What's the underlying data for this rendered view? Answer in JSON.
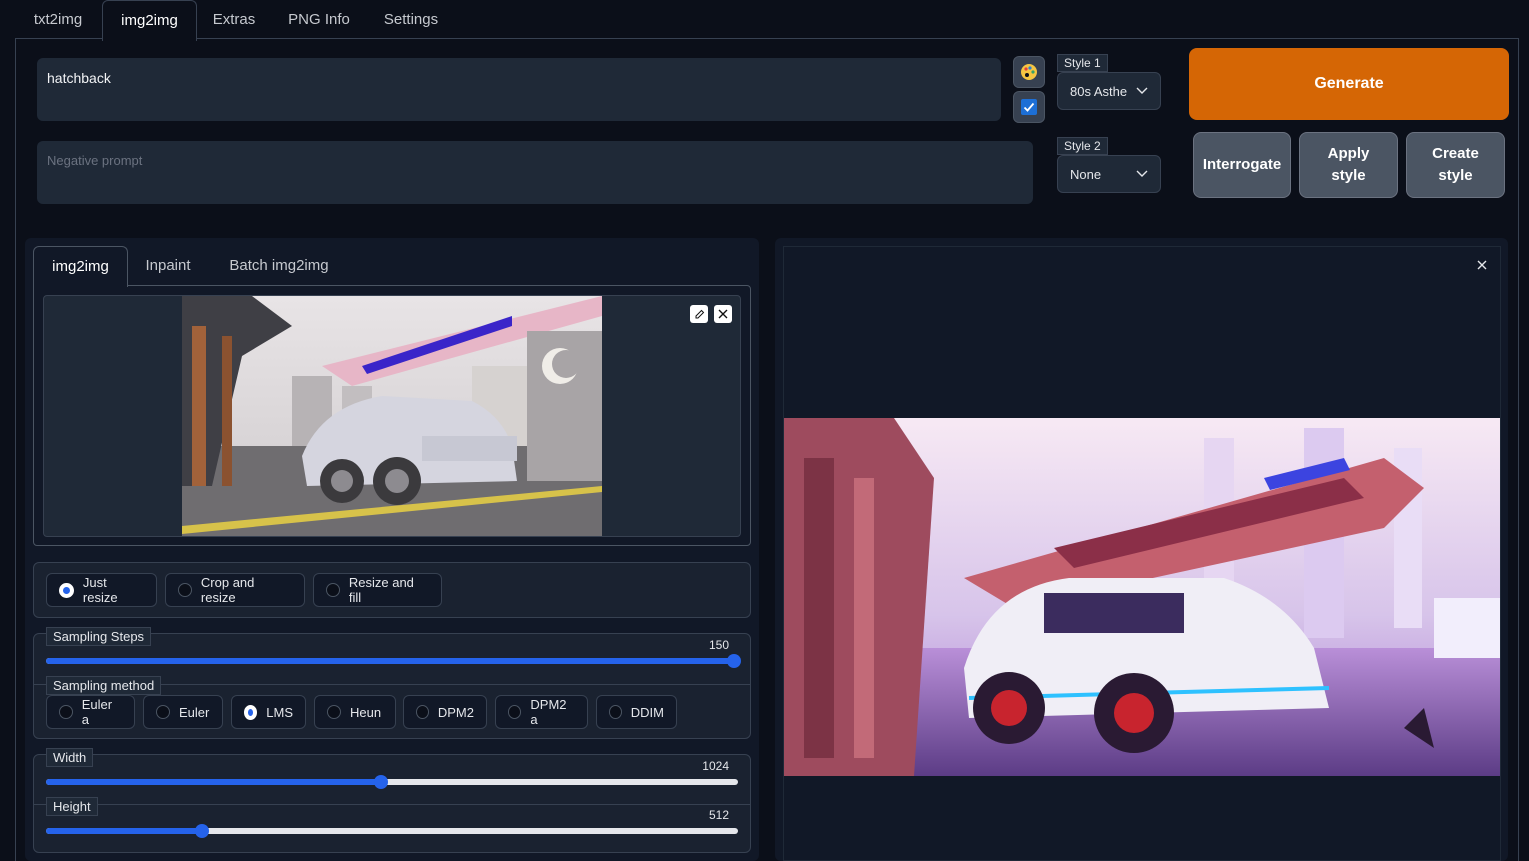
{
  "tabs": [
    "txt2img",
    "img2img",
    "Extras",
    "PNG Info",
    "Settings"
  ],
  "prompt": "hatchback",
  "negative_prompt_placeholder": "Negative prompt",
  "styles": {
    "style1_label": "Style 1",
    "style1_value": "80s Asthe",
    "style2_label": "Style 2",
    "style2_value": "None"
  },
  "buttons": {
    "generate": "Generate",
    "interrogate": "Interrogate",
    "apply_style": "Apply style",
    "create_style": "Create style"
  },
  "sub_tabs": [
    "img2img",
    "Inpaint",
    "Batch img2img"
  ],
  "resize_modes": [
    "Just resize",
    "Crop and resize",
    "Resize and fill"
  ],
  "resize_selected": "Just resize",
  "sampling_steps": {
    "label": "Sampling Steps",
    "value": 150,
    "min": 1,
    "max": 150
  },
  "sampling_method": {
    "label": "Sampling method",
    "options": [
      "Euler a",
      "Euler",
      "LMS",
      "Heun",
      "DPM2",
      "DPM2 a",
      "DDIM"
    ],
    "selected": "LMS"
  },
  "width": {
    "label": "Width",
    "value": 1024,
    "min": 64,
    "max": 2048
  },
  "height": {
    "label": "Height",
    "value": 512,
    "min": 64,
    "max": 2048
  },
  "colors": {
    "accent": "#2563eb",
    "generate": "#d56605",
    "background": "#0b0f19"
  }
}
